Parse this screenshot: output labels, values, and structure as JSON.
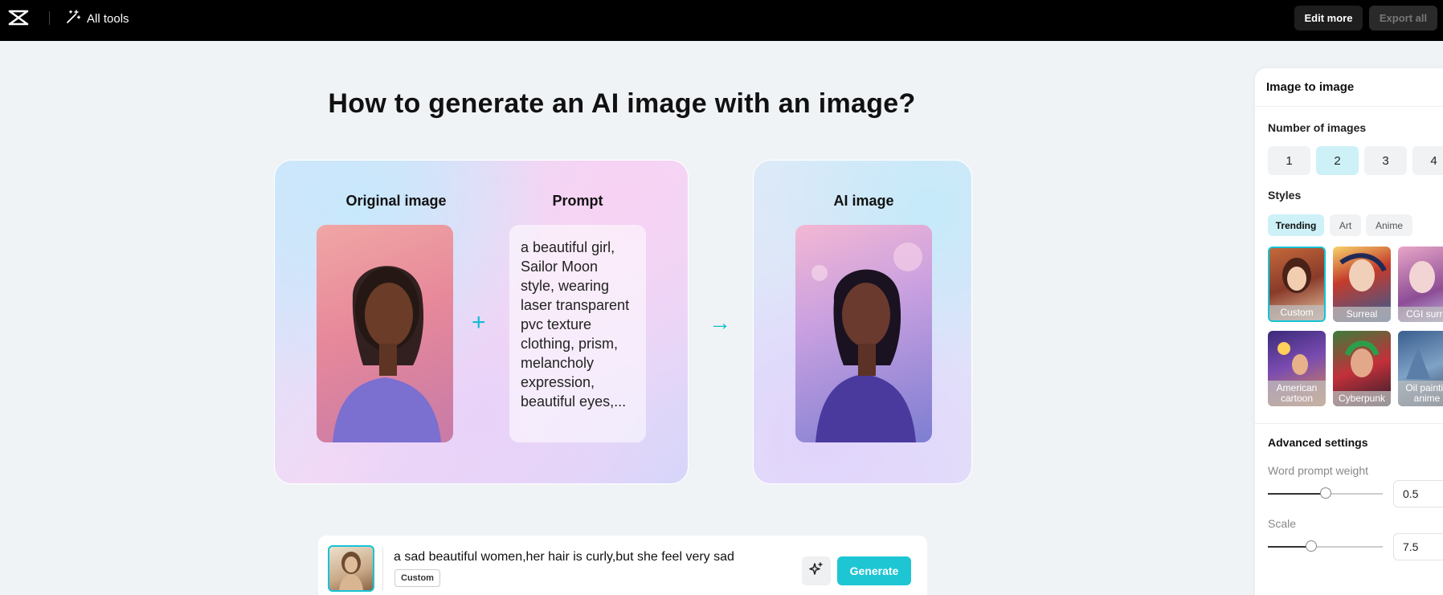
{
  "topbar": {
    "all_tools": "All tools",
    "edit_more": "Edit more",
    "export_all": "Export all"
  },
  "main": {
    "heading": "How to generate an AI image with an image?",
    "card1": {
      "original_title": "Original image",
      "prompt_title": "Prompt",
      "prompt_text": "a beautiful girl, Sailor Moon style, wearing laser transparent pvc texture clothing, prism, melancholy expression, beautiful eyes,..."
    },
    "card2": {
      "ai_title": "AI image"
    }
  },
  "prompt_bar": {
    "text": "a sad beautiful women,her hair is curly,but she feel very sad",
    "style_tag": "Custom",
    "generate": "Generate"
  },
  "panel": {
    "title": "Image to image",
    "num_images_label": "Number of images",
    "num_options": [
      "1",
      "2",
      "3",
      "4"
    ],
    "num_selected": "2",
    "styles_label": "Styles",
    "style_tabs": [
      "Trending",
      "Art",
      "Anime"
    ],
    "style_tab_selected": "Trending",
    "styles": [
      "Custom",
      "Surreal",
      "CGI surre",
      "American cartoon",
      "Cyberpunk",
      "Oil paintin anime"
    ],
    "style_selected": "Custom",
    "advanced_label": "Advanced settings",
    "word_weight_label": "Word prompt weight",
    "word_weight_value": "0.5",
    "scale_label": "Scale",
    "scale_value": "7.5",
    "word_weight_fraction": 0.5,
    "scale_fraction": 0.375
  },
  "colors": {
    "accent": "#1ec6d4",
    "selected_bg": "#cdf1f7",
    "topbar": "#000000"
  }
}
